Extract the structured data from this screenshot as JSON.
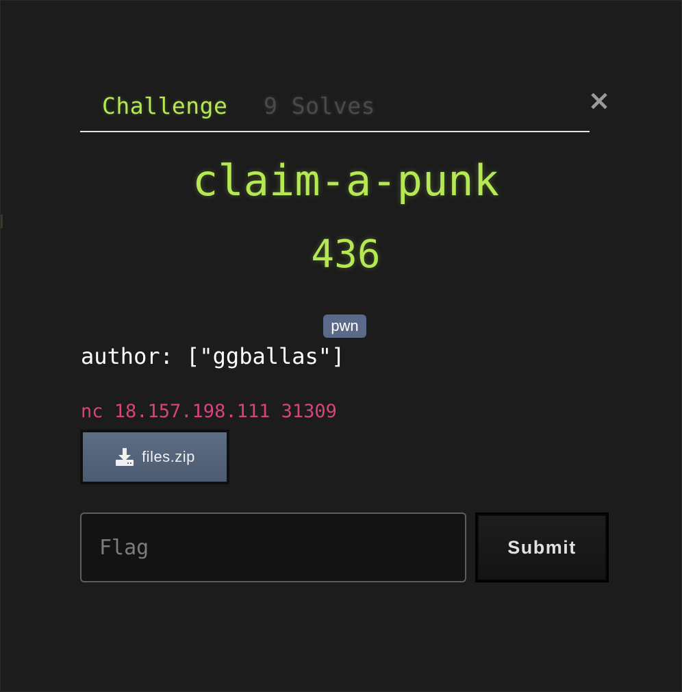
{
  "tabs": [
    {
      "label": "Challenge",
      "active": true
    },
    {
      "label": "9 Solves",
      "active": false
    }
  ],
  "close_icon": "close-icon",
  "challenge": {
    "name": "claim-a-punk",
    "points": "436",
    "tag": "pwn",
    "author_line": "author: [\"ggballas\"]",
    "connection": "nc 18.157.198.111 31309"
  },
  "files": [
    {
      "label": "files.zip",
      "icon": "download-icon"
    }
  ],
  "flag_form": {
    "placeholder": "Flag",
    "value": "",
    "submit_label": "Submit"
  },
  "colors": {
    "accent": "#b5e853",
    "tag_bg": "#5c6a8a",
    "connection_text": "#d9437c",
    "file_button": "#56657b",
    "background": "#1c1c1c"
  }
}
